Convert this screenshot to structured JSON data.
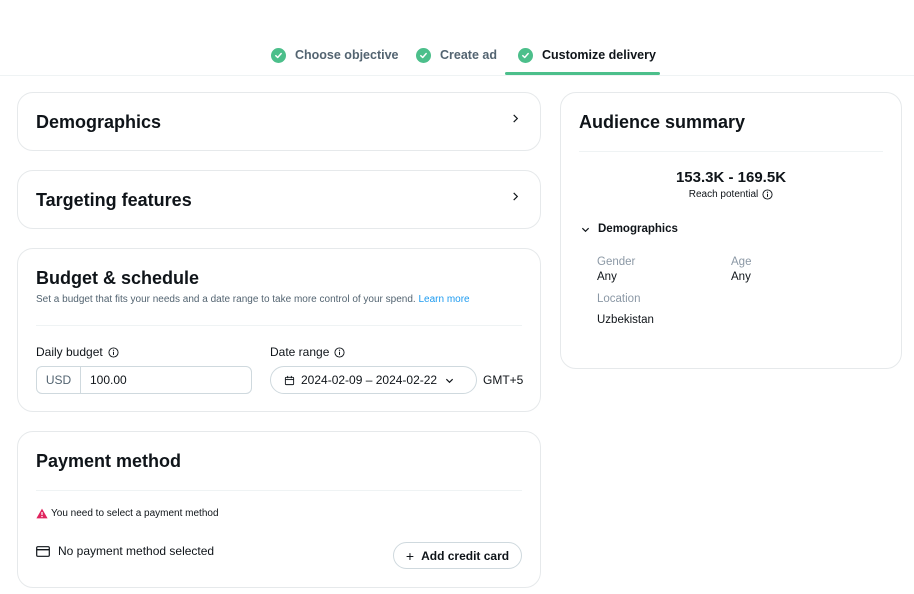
{
  "stepper": {
    "steps": [
      {
        "label": "Choose objective",
        "completed": true,
        "active": false
      },
      {
        "label": "Create ad",
        "completed": true,
        "active": false
      },
      {
        "label": "Customize delivery",
        "completed": true,
        "active": true
      }
    ],
    "accent_color": "#4cbf8b"
  },
  "demographics_card": {
    "title": "Demographics"
  },
  "targeting_card": {
    "title": "Targeting features"
  },
  "budget_card": {
    "title": "Budget & schedule",
    "description": "Set a budget that fits your needs and a date range to take more control of your spend.",
    "learn_more": "Learn more",
    "daily_budget_label": "Daily budget",
    "currency": "USD",
    "amount": "100.00",
    "date_range_label": "Date range",
    "date_range_value": "2024-02-09 – 2024-02-22",
    "timezone": "GMT+5"
  },
  "payment_card": {
    "title": "Payment method",
    "warning": "You need to select a payment method",
    "no_method": "No payment method selected",
    "add_card_label": "Add credit card"
  },
  "audience": {
    "title": "Audience summary",
    "reach": "153.3K - 169.5K",
    "reach_label": "Reach potential",
    "demographics_label": "Demographics",
    "gender_label": "Gender",
    "gender_value": "Any",
    "age_label": "Age",
    "age_value": "Any",
    "location_label": "Location",
    "location_value": "Uzbekistan"
  },
  "colors": {
    "link": "#1d9bf0",
    "warning": "#f4212e",
    "success": "#4cbf8b"
  }
}
